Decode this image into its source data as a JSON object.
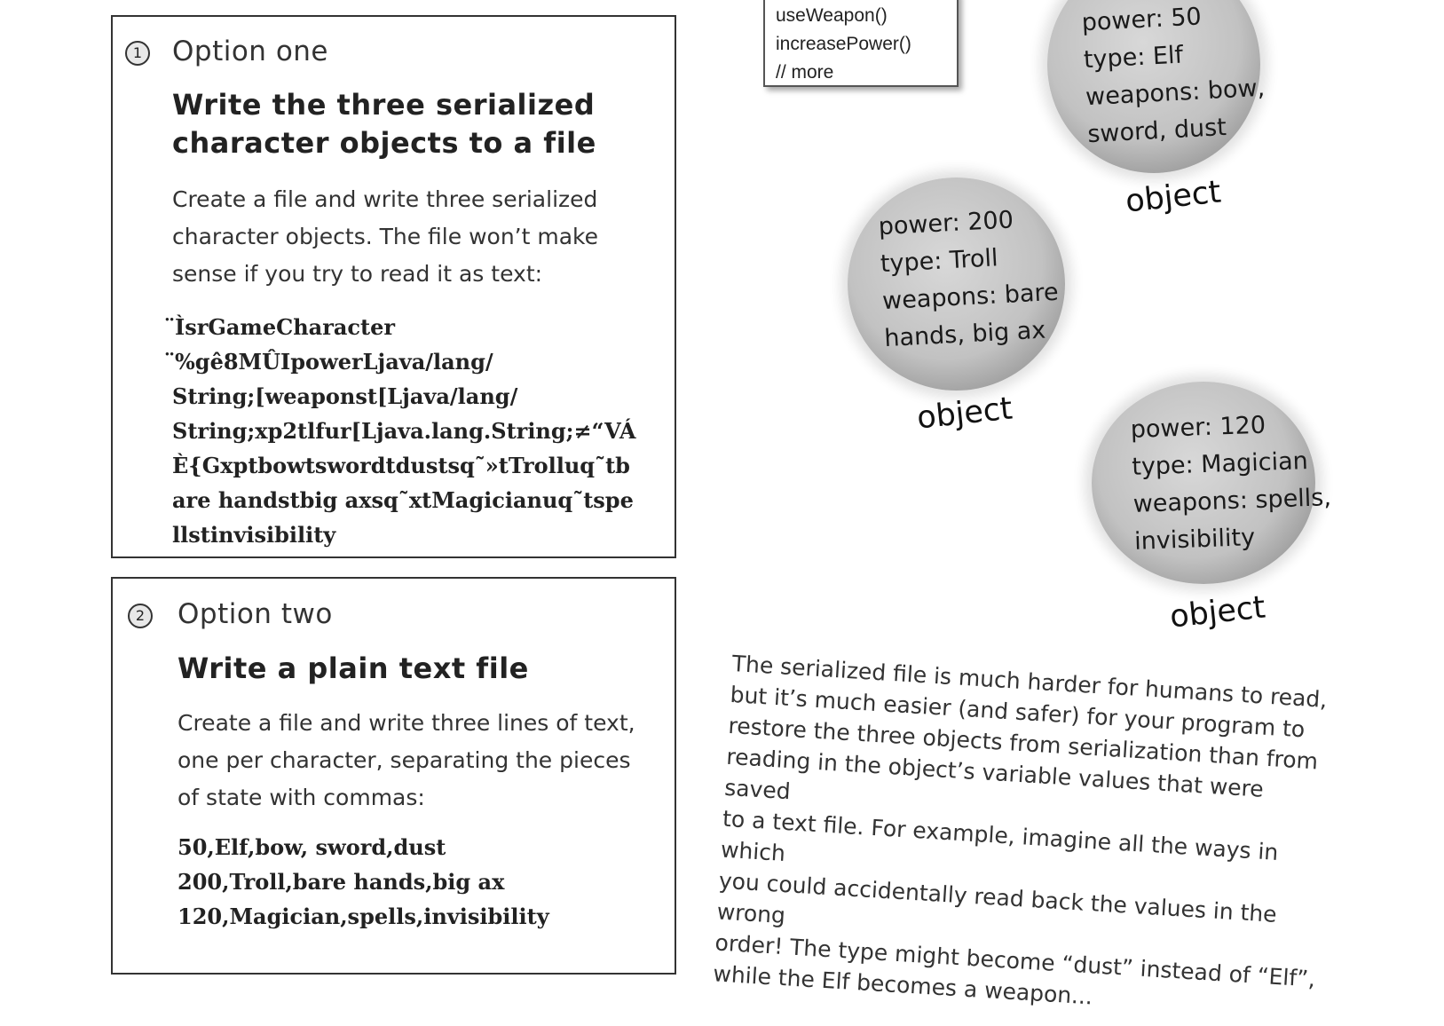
{
  "option_one": {
    "number": "1",
    "title": "Option one",
    "heading_lines": [
      "Write the three serialized",
      "character objects to a file"
    ],
    "description_lines": [
      "Create a file and write three serialized",
      "character objects. The file won’t make",
      "sense if you try to read it as text:"
    ],
    "serialized_lines": [
      "¨ÌsrGameCharacter",
      "¨%gê8MÛIpowerLjava/lang/",
      "String;[weaponst[Ljava/lang/",
      "String;xp2tlfur[Ljava.lang.String;≠“VÁ",
      "È{Gxptbowtswordtdustsq˜»tTrolluq˜tb",
      "are handstbig axsq˜xtMagicianuq˜tspe",
      "llstinvisibility"
    ]
  },
  "option_two": {
    "number": "2",
    "title": "Option two",
    "heading": "Write a plain text file",
    "description_lines": [
      "Create a file and write three lines of text,",
      "one per character, separating the pieces",
      "of state with commas:"
    ],
    "text_lines": [
      "50,Elf,bow, sword,dust",
      "200,Troll,bare hands,big ax",
      "120,Magician,spells,invisibility"
    ]
  },
  "method_card": {
    "lines": [
      "useWeapon()",
      "increasePower()",
      "// more"
    ]
  },
  "objects": [
    {
      "lines": [
        "power: 50",
        "type: Elf",
        "weapons: bow,",
        "sword, dust"
      ],
      "label": "object"
    },
    {
      "lines": [
        "power: 200",
        "type: Troll",
        "weapons: bare",
        "hands, big ax"
      ],
      "label": "object"
    },
    {
      "lines": [
        "power: 120",
        "type: Magician",
        "weapons: spells,",
        "invisibility"
      ],
      "label": "object"
    }
  ],
  "note_lines": [
    "The serialized file is much harder for humans to read,",
    "but it’s much easier (and safer) for your program to",
    "restore the three objects from serialization than from",
    "reading in the object’s variable values that were saved",
    "to a text file. For example, imagine all the ways in which",
    "you could accidentally read back the values in the wrong",
    "order! The type might become “dust” instead of “Elf”,",
    "while the Elf becomes a weapon..."
  ]
}
